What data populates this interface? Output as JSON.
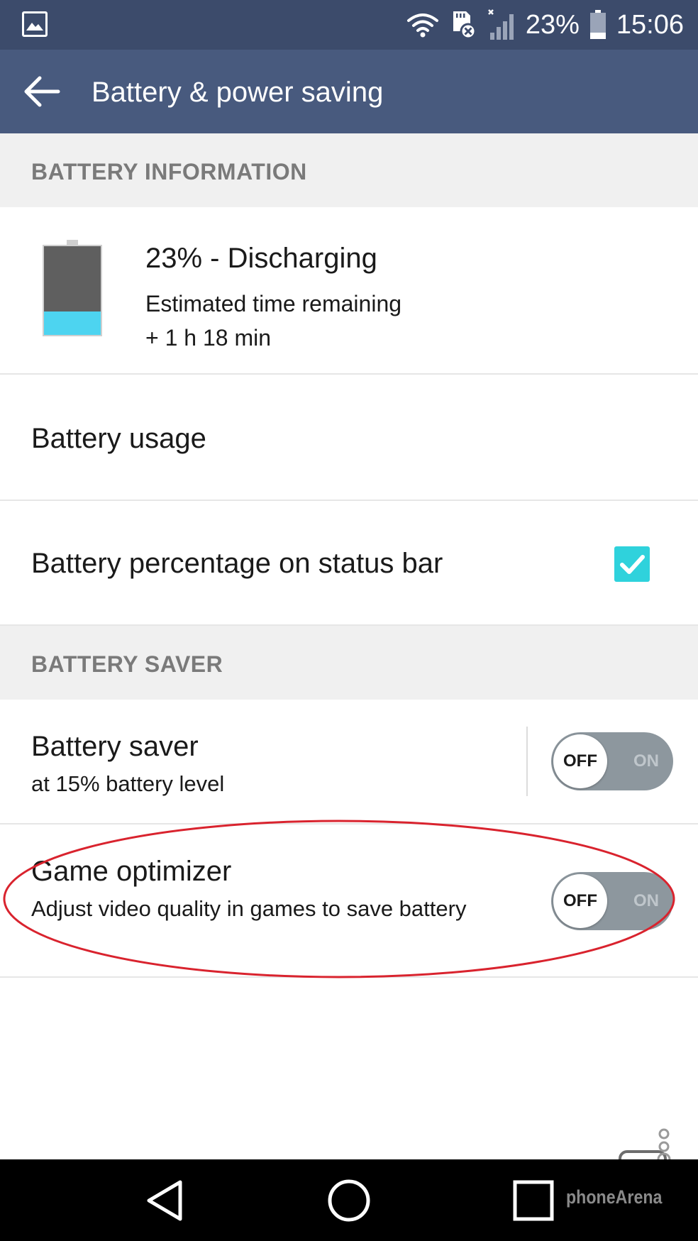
{
  "status_bar": {
    "battery_percent": "23%",
    "time": "15:06",
    "icons": [
      "gallery-icon",
      "wifi-icon",
      "sd-card-icon",
      "signal-icon",
      "battery-icon"
    ]
  },
  "app_bar": {
    "title": "Battery & power saving",
    "back_icon": "arrow-left-icon"
  },
  "battery_information": {
    "header": "BATTERY INFORMATION",
    "status": "23% - Discharging",
    "estimate_label": "Estimated time remaining",
    "estimate_value": "+ 1 h 18 min",
    "level": 0.23,
    "fill_color": "#4dd4f0"
  },
  "battery_usage": {
    "label": "Battery usage"
  },
  "battery_percentage": {
    "label": "Battery percentage on status bar",
    "checked": true
  },
  "battery_saver_section": {
    "header": "BATTERY SAVER"
  },
  "battery_saver": {
    "title": "Battery saver",
    "subtitle": "at 15% battery level",
    "off_label": "OFF",
    "on_label": "ON",
    "state": "OFF"
  },
  "game_optimizer": {
    "title": "Game optimizer",
    "subtitle": "Adjust video quality in games to save battery",
    "off_label": "OFF",
    "on_label": "ON",
    "state": "OFF"
  },
  "nav_bar": {
    "icons": [
      "back-triangle-icon",
      "home-circle-icon",
      "recents-square-icon"
    ]
  },
  "watermark": {
    "text": "phoneArena"
  },
  "colors": {
    "status_bar": "#3c4b6b",
    "app_bar": "#485a7e",
    "accent": "#2fd2dc",
    "annotation": "#d9232e"
  }
}
